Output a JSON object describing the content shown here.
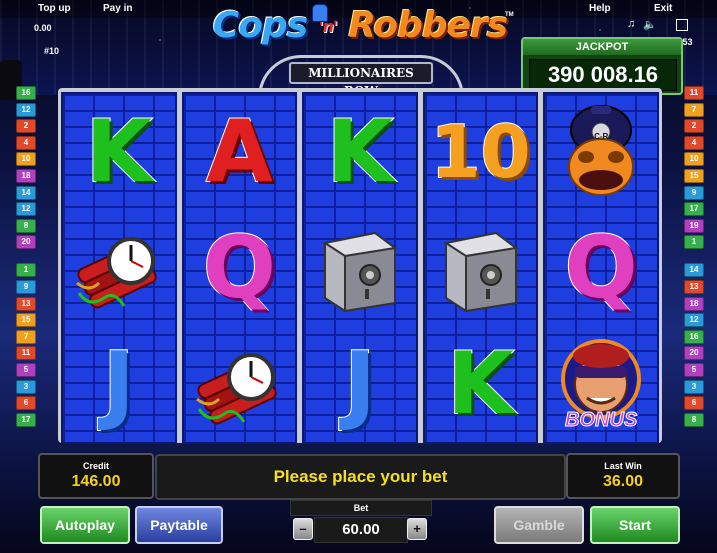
{
  "topbar": {
    "topup_label": "Top up",
    "payin_label": "Pay in",
    "help_label": "Help",
    "exit_label": "Exit",
    "balance_small": "0.00",
    "game_id": "#10",
    "clock": "11:53",
    "music_icon": "music-note-icon",
    "sound_icon": "speaker-icon",
    "fullscreen_icon": "fullscreen-icon"
  },
  "logo": {
    "cops": "Cops",
    "n": "'n'",
    "robbers": "Robbers",
    "subtitle": "MILLIONAIRES ROW",
    "tm": "TM"
  },
  "jackpot": {
    "label": "JACKPOT",
    "value": "390 008.16"
  },
  "reels": [
    [
      "K",
      "dynamite",
      "J"
    ],
    [
      "A",
      "Q",
      "dynamite"
    ],
    [
      "K",
      "safe",
      "J"
    ],
    [
      "10",
      "safe",
      "K"
    ],
    [
      "policeman",
      "Q",
      "robber-bonus"
    ]
  ],
  "bonus_text": "BONUS",
  "policeman_badge": "C-R",
  "line_numbers_left": [
    {
      "n": "16",
      "color": "#36b04a"
    },
    {
      "n": "12",
      "color": "#2a9ad8"
    },
    {
      "n": "2",
      "color": "#e04a2a"
    },
    {
      "n": "4",
      "color": "#e04a2a"
    },
    {
      "n": "10",
      "color": "#f0a020"
    },
    {
      "n": "18",
      "color": "#b040c0"
    },
    {
      "n": "14",
      "color": "#2a9ad8"
    },
    {
      "n": "12",
      "color": "#2a9ad8"
    },
    {
      "n": "8",
      "color": "#36b04a"
    },
    {
      "n": "20",
      "color": "#b040c0"
    },
    {
      "n": "1",
      "color": "#36b04a"
    },
    {
      "n": "9",
      "color": "#2a9ad8"
    },
    {
      "n": "13",
      "color": "#e04a2a"
    },
    {
      "n": "15",
      "color": "#f0a020"
    },
    {
      "n": "7",
      "color": "#f0a020"
    },
    {
      "n": "11",
      "color": "#e04a2a"
    },
    {
      "n": "5",
      "color": "#b040c0"
    },
    {
      "n": "3",
      "color": "#2a9ad8"
    },
    {
      "n": "6",
      "color": "#e04a2a"
    },
    {
      "n": "17",
      "color": "#36b04a"
    }
  ],
  "line_numbers_right": [
    {
      "n": "11",
      "color": "#e04a2a"
    },
    {
      "n": "7",
      "color": "#f0a020"
    },
    {
      "n": "2",
      "color": "#e04a2a"
    },
    {
      "n": "4",
      "color": "#e04a2a"
    },
    {
      "n": "10",
      "color": "#f0a020"
    },
    {
      "n": "15",
      "color": "#f0a020"
    },
    {
      "n": "9",
      "color": "#2a9ad8"
    },
    {
      "n": "17",
      "color": "#36b04a"
    },
    {
      "n": "19",
      "color": "#b040c0"
    },
    {
      "n": "1",
      "color": "#36b04a"
    },
    {
      "n": "14",
      "color": "#2a9ad8"
    },
    {
      "n": "13",
      "color": "#e04a2a"
    },
    {
      "n": "18",
      "color": "#b040c0"
    },
    {
      "n": "12",
      "color": "#2a9ad8"
    },
    {
      "n": "16",
      "color": "#36b04a"
    },
    {
      "n": "20",
      "color": "#b040c0"
    },
    {
      "n": "5",
      "color": "#b040c0"
    },
    {
      "n": "3",
      "color": "#2a9ad8"
    },
    {
      "n": "6",
      "color": "#e04a2a"
    },
    {
      "n": "8",
      "color": "#36b04a"
    }
  ],
  "credit": {
    "label": "Credit",
    "value": "146.00"
  },
  "message": "Please place your bet",
  "last_win": {
    "label": "Last Win",
    "value": "36.00"
  },
  "buttons": {
    "autoplay": "Autoplay",
    "paytable": "Paytable",
    "gamble": "Gamble",
    "start": "Start",
    "minus": "–",
    "plus": "+"
  },
  "bet": {
    "label": "Bet",
    "value": "60.00"
  }
}
